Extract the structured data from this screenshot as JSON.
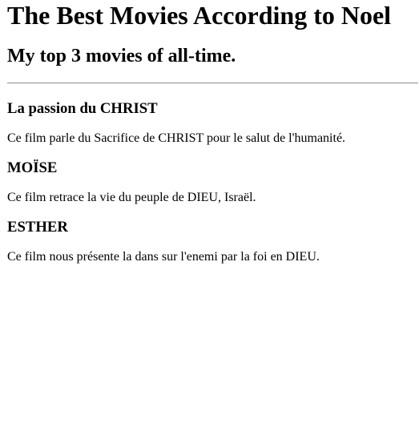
{
  "page": {
    "title": "The Best Movies According to Noel",
    "subtitle": "My top 3 movies of all-time."
  },
  "movies": [
    {
      "title": "La passion du CHRIST",
      "description": "Ce film parle du Sacrifice de CHRIST pour le salut de l'humanité."
    },
    {
      "title": "MOÏSE",
      "description": "Ce film retrace la vie du peuple de DIEU, Israël."
    },
    {
      "title": "ESTHER",
      "description": "Ce film nous présente la dans sur l'enemi par la foi en DIEU."
    }
  ]
}
